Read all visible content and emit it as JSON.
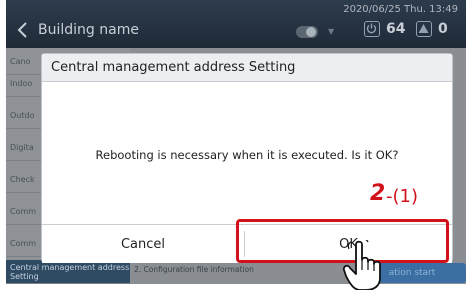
{
  "header": {
    "title": "Building name",
    "datetime": "2020/06/25 Thu. 13:49",
    "power_count": "64",
    "warning_count": "0"
  },
  "sidebar": {
    "items": [
      {
        "label": "Cano"
      },
      {
        "label": "Indoo"
      },
      {
        "label": "Outdo"
      },
      {
        "label": "Digita"
      },
      {
        "label": "Check"
      },
      {
        "label": "Comm"
      },
      {
        "label": "Comm"
      },
      {
        "label": "Central management address Setting"
      }
    ]
  },
  "main": {
    "info_label": "2. Configuration file information",
    "execute_button": "ation start"
  },
  "dialog": {
    "title": "Central management address Setting",
    "message": "Rebooting is necessary when it is executed. Is it OK?",
    "cancel_label": "Cancel",
    "ok_label": "OK"
  },
  "annotation": {
    "step": "2",
    "substep": "-(1)",
    "highlight_color": "#d2121b"
  }
}
